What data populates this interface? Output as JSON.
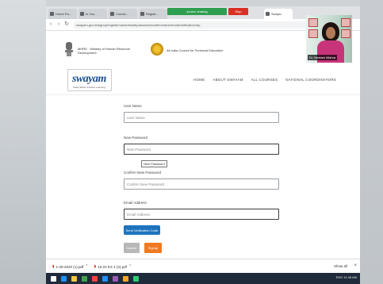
{
  "browser": {
    "tabs": [
      {
        "label": "Home Pa...",
        "active": false
      },
      {
        "label": "In You...",
        "active": false
      },
      {
        "label": "Course...",
        "active": false
      },
      {
        "label": "Registr...",
        "active": false
      },
      {
        "label": "Swaya...",
        "active": true
      }
    ],
    "share_banner": "screen sharing",
    "stop_label": "Stop",
    "url": "swayam.gov.in/signup/register/name/email/password/confirm/name/email/verification/otp"
  },
  "gov_header": {
    "mhrd_text": "MHRD · Ministry of Human Resource Development",
    "aicte_text": "All India Council for Technical Education"
  },
  "webcam": {
    "nametag": "Dr. Neelam Mishra"
  },
  "nav": {
    "logo_text": "swayam",
    "logo_sub": "Study Webs of Active Learning",
    "menu": [
      "HOME",
      "ABOUT SWAYAM",
      "ALL COURSES",
      "NATIONAL COORDINATORS"
    ]
  },
  "form": {
    "username_label": "User Name",
    "username_placeholder": "User Name",
    "password_label": "New Password",
    "password_placeholder": "New Password",
    "tooltip": "New Password",
    "confirm_label": "Confirm New Password",
    "confirm_placeholder": "Confirm New Password",
    "email_label": "Email Address",
    "email_placeholder": "Email Address",
    "otp_button": "Send Verification Code",
    "cancel_button": "Cancel",
    "signup_button": "Signup"
  },
  "downloads": {
    "items": [
      "1-29-2020 (1).pdf",
      "10-22 EX 4 (2).pdf"
    ],
    "show_all": "Show all"
  },
  "taskbar": {
    "tray": "ENG 11:48 AM",
    "icon_colors": [
      "#1e90ff",
      "#f5c542",
      "#3fa34d",
      "#e44",
      "#1e90ff",
      "#9b59b6",
      "#f5a623",
      "#2ecc71"
    ]
  }
}
